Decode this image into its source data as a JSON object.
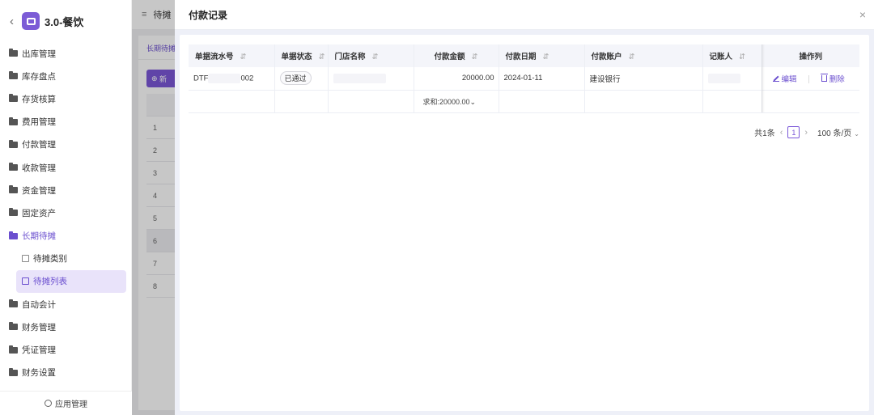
{
  "sidebar": {
    "title": "3.0-餐饮",
    "items": [
      {
        "label": "出库管理"
      },
      {
        "label": "库存盘点"
      },
      {
        "label": "存货核算"
      },
      {
        "label": "费用管理"
      },
      {
        "label": "付款管理"
      },
      {
        "label": "收款管理"
      },
      {
        "label": "资金管理"
      },
      {
        "label": "固定资产"
      },
      {
        "label": "长期待摊"
      },
      {
        "label": "待摊类别"
      },
      {
        "label": "待摊列表"
      },
      {
        "label": "自动会计"
      },
      {
        "label": "财务管理"
      },
      {
        "label": "凭证管理"
      },
      {
        "label": "财务设置"
      }
    ],
    "footer": "应用管理"
  },
  "background": {
    "topbar_title": "待摊",
    "tab_label": "长期待摊",
    "add_button": "新",
    "row_numbers": [
      "1",
      "2",
      "3",
      "4",
      "5",
      "6",
      "7",
      "8"
    ]
  },
  "drawer": {
    "title": "付款记录",
    "close_icon": "×",
    "columns": [
      "单据流水号",
      "单据状态",
      "门店名称",
      "付款金额",
      "付款日期",
      "付款账户",
      "记账人",
      "操作列"
    ],
    "rows": [
      {
        "serial_prefix": "DTF",
        "serial_suffix": "002",
        "status": "已通过",
        "amount": "20000.00",
        "date": "2024-01-11",
        "account": "建设银行",
        "edit_label": "编辑",
        "delete_label": "删除"
      }
    ],
    "summary": {
      "amount": "求和:20000.00"
    },
    "pagination": {
      "total": "共1条",
      "current_page": "1",
      "page_size": "100 条/页"
    }
  }
}
